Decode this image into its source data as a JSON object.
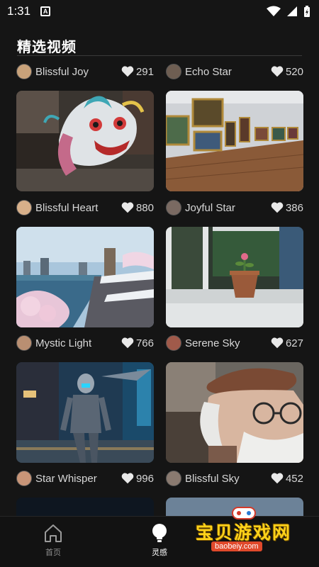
{
  "status_bar": {
    "time": "1:31",
    "app_icon_letter": "A"
  },
  "page": {
    "title": "精选视频"
  },
  "cards": [
    {
      "author": "Blissful Joy",
      "likes": "291",
      "avatar_color": "#c9a27a",
      "scene": "top-clip"
    },
    {
      "author": "Echo Star",
      "likes": "520",
      "avatar_color": "#6e5e52",
      "scene": "top-clip"
    },
    {
      "author": "Blissful Heart",
      "likes": "880",
      "avatar_color": "#d8b08a",
      "scene": "dragon-parade"
    },
    {
      "author": "Joyful Star",
      "likes": "386",
      "avatar_color": "#7a6a62",
      "scene": "art-gallery"
    },
    {
      "author": "Mystic Light",
      "likes": "766",
      "avatar_color": "#b98f72",
      "scene": "cherry-blossom-city"
    },
    {
      "author": "Serene Sky",
      "likes": "627",
      "avatar_color": "#a05a4a",
      "scene": "flower-pot-window"
    },
    {
      "author": "Star Whisper",
      "likes": "996",
      "avatar_color": "#c89578",
      "scene": "cyborg-street"
    },
    {
      "author": "Blissful Sky",
      "likes": "452",
      "avatar_color": "#8a7a70",
      "scene": "old-man-beret"
    }
  ],
  "bottom_nav": {
    "items": [
      {
        "label": "首页",
        "icon": "home-icon",
        "active": false
      },
      {
        "label": "灵感",
        "icon": "lightbulb-icon",
        "active": true
      }
    ]
  },
  "watermark": {
    "text": "宝贝游戏网",
    "url": "baobeiy.com"
  }
}
